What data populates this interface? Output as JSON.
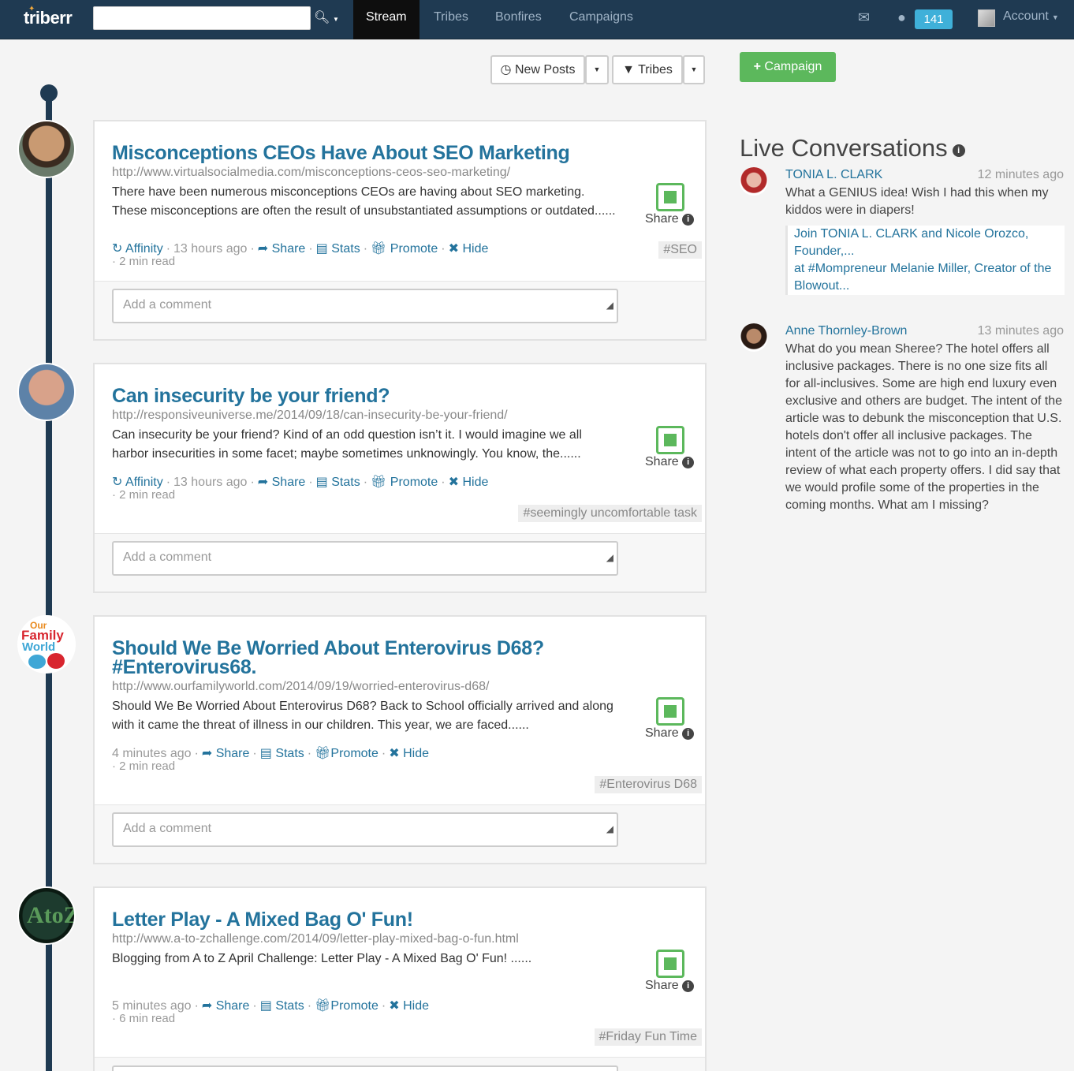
{
  "nav": {
    "logo": "triberr",
    "search_placeholder": "",
    "tabs": [
      "Stream",
      "Tribes",
      "Bonfires",
      "Campaigns"
    ],
    "active_tab": "Stream",
    "notifications_count": "141",
    "account_label": "Account"
  },
  "toolbar": {
    "new_posts_label": "New Posts",
    "tribes_label": "Tribes",
    "campaign_label": "Campaign"
  },
  "posts": [
    {
      "title": "Misconceptions CEOs Have About SEO Marketing",
      "url": "http://www.virtualsocialmedia.com/misconceptions-ceos-seo-marketing/",
      "description": "There have been numerous misconceptions CEOs are having about SEO marketing. These misconceptions are often the result of unsubstantiated assumptions or outdated......",
      "affinity": "Affinity",
      "time": "13 hours ago",
      "share": "Share",
      "stats": "Stats",
      "promote": "Promote",
      "hide": "Hide",
      "read_time": "· 2 min read",
      "tag": "#SEO",
      "share_box_label": "Share",
      "comment_placeholder": "Add a comment"
    },
    {
      "title": "Can insecurity be your friend?",
      "url": "http://responsiveuniverse.me/2014/09/18/can-insecurity-be-your-friend/",
      "description": "Can insecurity be your friend? Kind of an odd question isn’t it. I would imagine we all harbor insecurities in some facet; maybe sometimes unknowingly.  You know, the......",
      "affinity": "Affinity",
      "time": "13 hours ago",
      "share": "Share",
      "stats": "Stats",
      "promote": "Promote",
      "hide": "Hide",
      "read_time": "· 2 min read",
      "tag": "#seemingly uncomfortable task",
      "share_box_label": "Share",
      "comment_placeholder": "Add a comment"
    },
    {
      "title": "Should We Be Worried About Enterovirus D68? #Enterovirus68.",
      "url": "http://www.ourfamilyworld.com/2014/09/19/worried-enterovirus-d68/",
      "description": "Should We Be Worried About Enterovirus D68?  Back to School officially arrived and along with it came the threat of illness in our children.  This year, we are faced......",
      "time": "4 minutes ago",
      "share": "Share",
      "stats": "Stats",
      "promote": "Promote",
      "hide": "Hide",
      "read_time": "· 2 min read",
      "tag": "#Enterovirus D68",
      "share_box_label": "Share",
      "comment_placeholder": "Add a comment",
      "avatar_text": [
        "Our",
        "Family",
        "World"
      ]
    },
    {
      "title": "Letter Play - A Mixed Bag O' Fun!",
      "url": "http://www.a-to-zchallenge.com/2014/09/letter-play-mixed-bag-o-fun.html",
      "description": "Blogging from A to Z April Challenge: Letter Play - A Mixed Bag O' Fun! ......",
      "time": "5 minutes ago",
      "share": "Share",
      "stats": "Stats",
      "promote": "Promote",
      "hide": "Hide",
      "read_time": "· 6 min read",
      "tag": "#Friday Fun Time",
      "share_box_label": "Share",
      "avatar_text": "AtoZ"
    }
  ],
  "sidebar": {
    "title": "Live Conversations",
    "conversations": [
      {
        "name": "TONIA L. CLARK",
        "time": "12 minutes ago",
        "text": "What a GENIUS idea! Wish I had this when my kiddos were in diapers!",
        "quote": "Join TONIA L. CLARK and Nicole Orozco, Founder,...\nat #Mompreneur Melanie Miller, Creator of the Blowout..."
      },
      {
        "name": "Anne Thornley-Brown",
        "time": "13 minutes ago",
        "text": "What do you mean Sheree? The hotel offers all inclusive packages. There is no one size fits all for all-inclusives. Some are high end luxury even exclusive and others are budget. The intent of the article was to debunk the misconception that U.S. hotels don't offer all inclusive packages. The intent of the article was not to go into an in-depth review of what each property offers. I did say that we would profile some of the properties in the coming months. What am I missing?"
      }
    ]
  }
}
